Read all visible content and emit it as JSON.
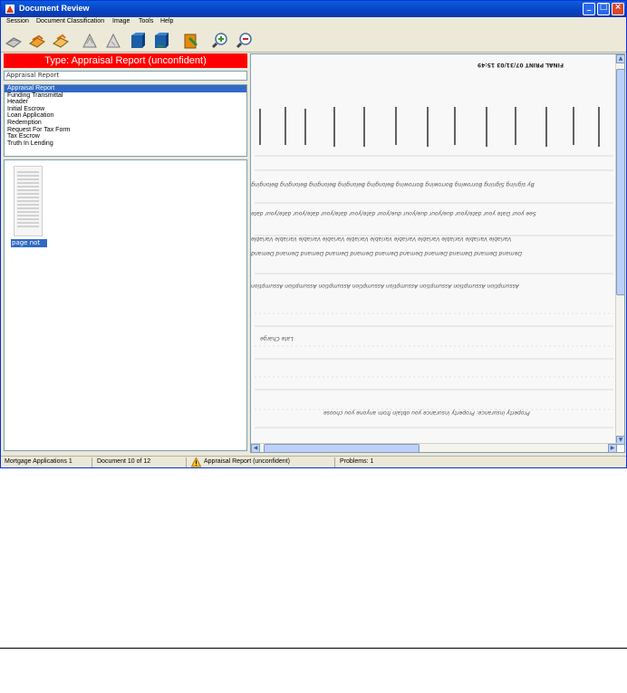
{
  "window": {
    "title": "Document Review"
  },
  "menu": [
    "Session",
    "Document Classification",
    "Image",
    "Tools",
    "Help"
  ],
  "toolbar_icons": [
    "open-icon",
    "save-icon",
    "refresh-icon",
    "rotate-left-icon",
    "rotate-right-icon",
    "previous-icon",
    "next-icon",
    "classify-icon",
    "zoom-in-icon",
    "zoom-out-icon"
  ],
  "type_banner": "Type: Appraisal Report (unconfident)",
  "classification_combo": "Appraisal Report",
  "classification_list": [
    "Appraisal Report",
    "Funding Transmittal",
    "Header",
    "Initial Escrow",
    "Loan Application",
    "Redemption",
    "Request For Tax Form",
    "Tax Escrow",
    "Truth In Lending"
  ],
  "thumbnail": {
    "label": "page not ..."
  },
  "document_text": {
    "header": "FINAL PRINT 07/31/03 15:49",
    "line_a": "By signing Signing Borrowing Borrowing Borrowing Belonging Belonging Belonging Belonging Belonging",
    "line_b": "See your Date your date/your due/your due/your due/your date/your date/your date/your date/your date",
    "line_c": "Variable Variable Variable Variable Variable Variable Variable Variable Variable Variable Variable",
    "line_d": "Demand Demand Demand Demand Demand Demand Demand Demand Demand Demand Demand",
    "line_e": "Assumption Assumption Assumption Assumption Assumption Assumption Assumption Assumption",
    "line_f": "Late Charge",
    "line_g": "Property insurance: Property insurance you obtain from anyone you choose"
  },
  "status": {
    "section": "Mortgage Applications 1",
    "document": "Document 10 of 12",
    "classification": "Appraisal Report (unconfident)",
    "problems": "Problems: 1"
  },
  "colors": {
    "banner": "#ff0000",
    "selection": "#316ac5",
    "titlebar": "#0a5ddc"
  }
}
